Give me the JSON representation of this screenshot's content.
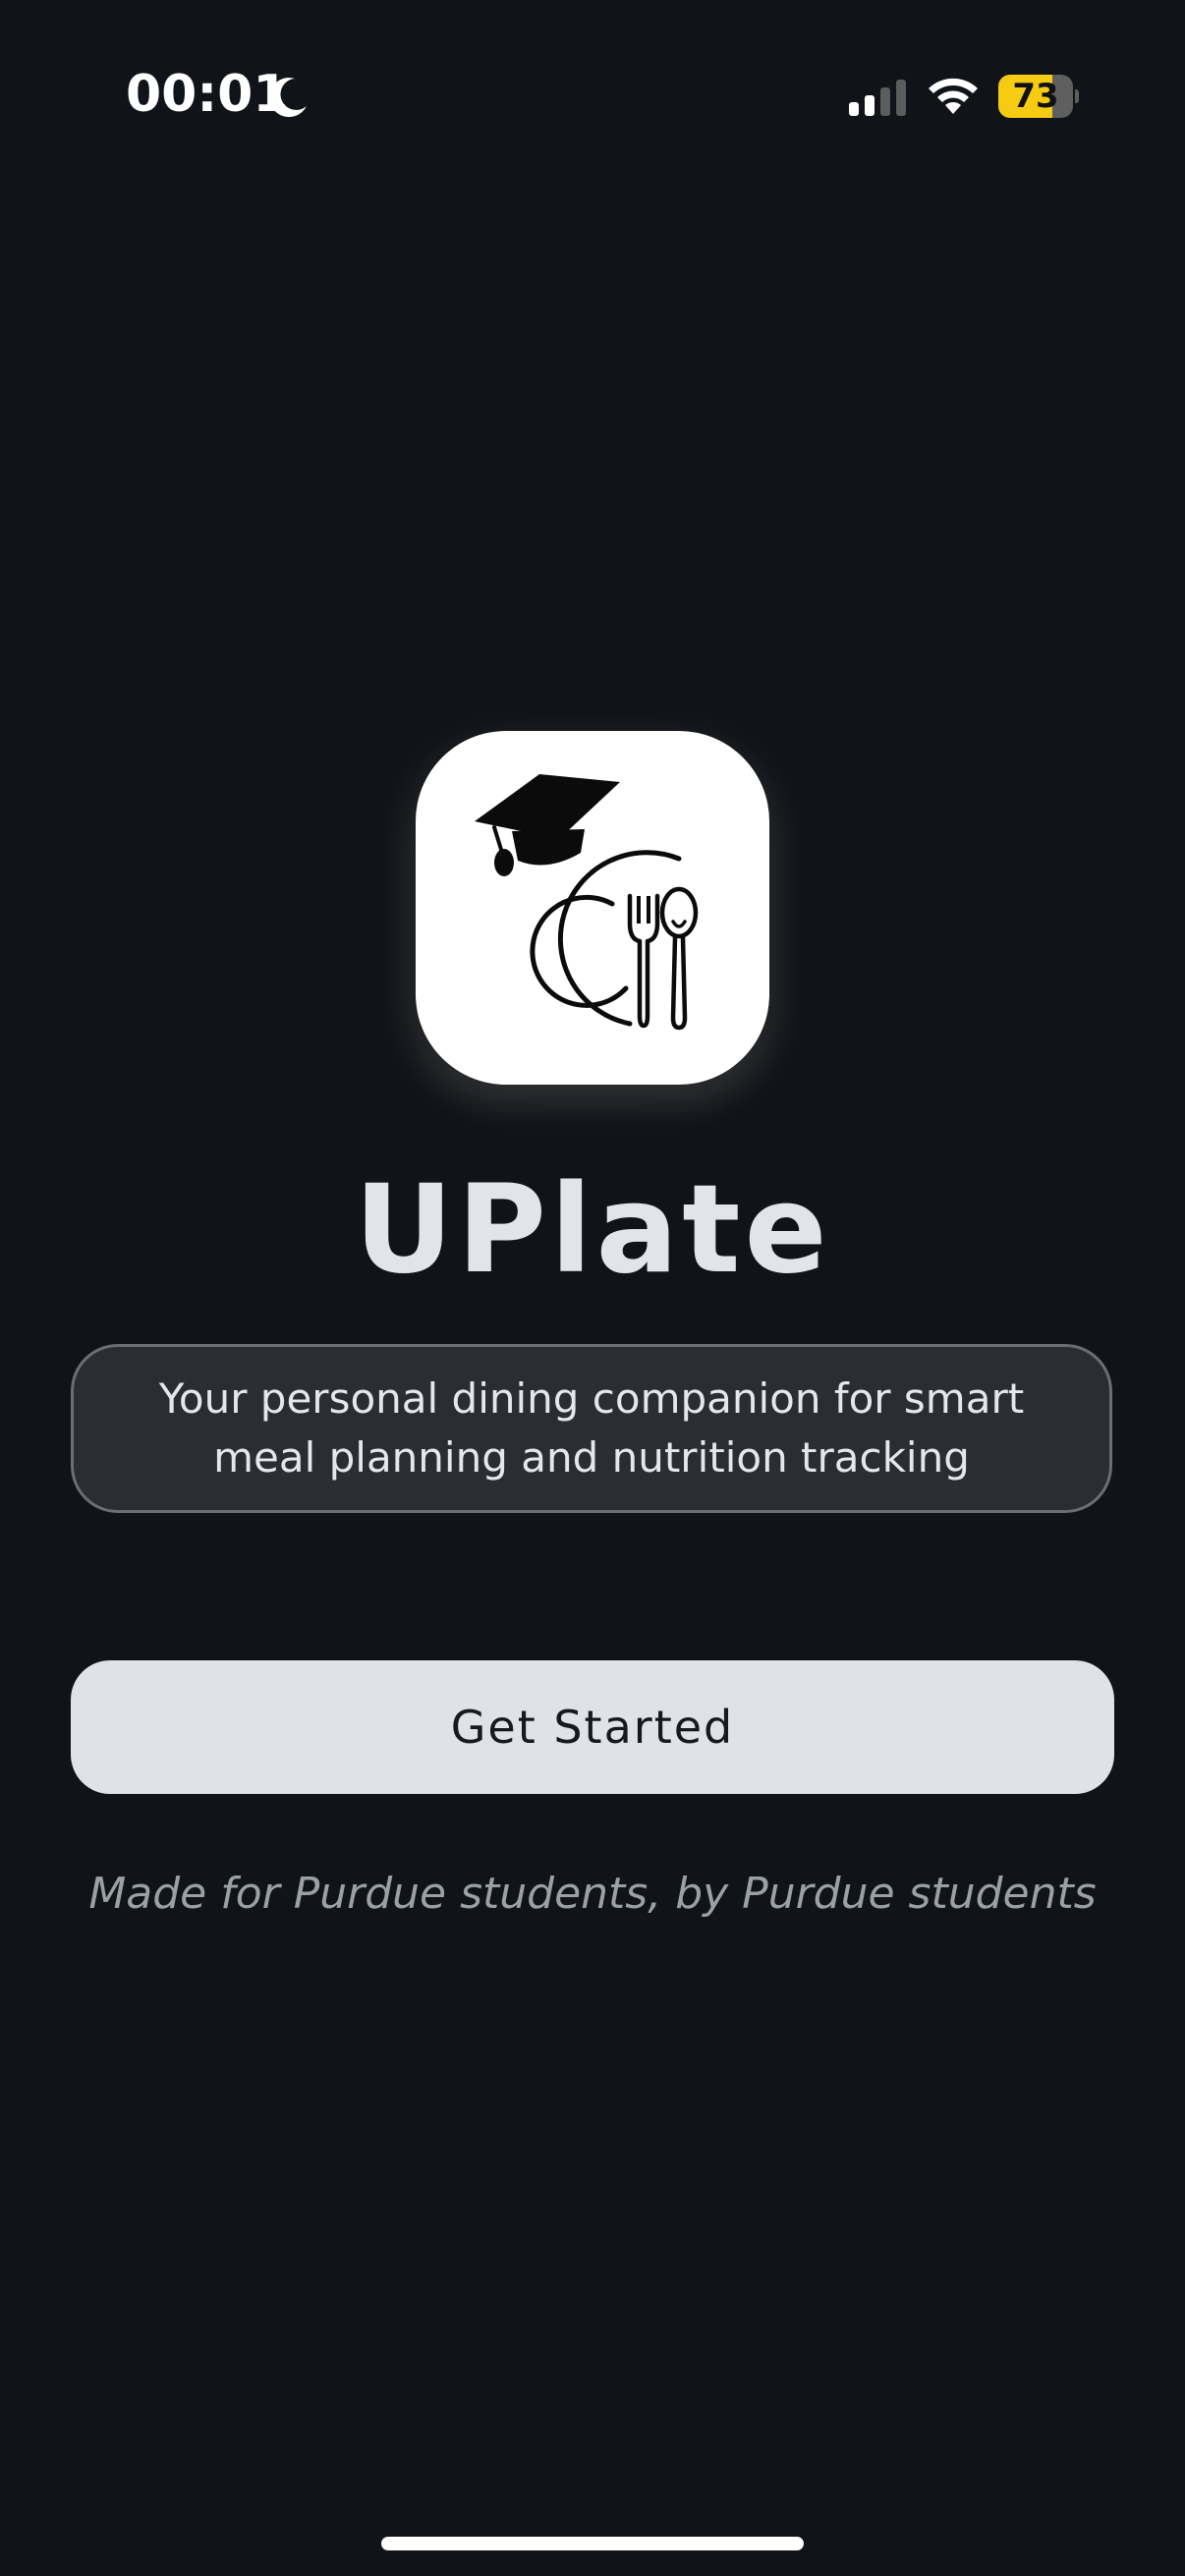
{
  "status_bar": {
    "time": "00:01",
    "focus_mode_icon": "moon-icon",
    "signal_icon": "cellular-signal-icon",
    "wifi_icon": "wifi-icon",
    "battery_percent": "73",
    "battery_level": 0.73,
    "battery_color": "#f5cc12"
  },
  "app": {
    "icon_name": "graduation-cap-plate-cutlery-icon",
    "name": "UPlate",
    "tagline": "Your personal dining companion for smart meal planning and nutrition tracking",
    "cta_label": "Get Started",
    "footer_note": "Made for Purdue students, by Purdue students"
  },
  "colors": {
    "background": "#101317",
    "title": "#e1e4e8",
    "tagline_box": "#2a2e33",
    "button": "#dfe2e7",
    "footer_text": "#9aa0a8"
  }
}
